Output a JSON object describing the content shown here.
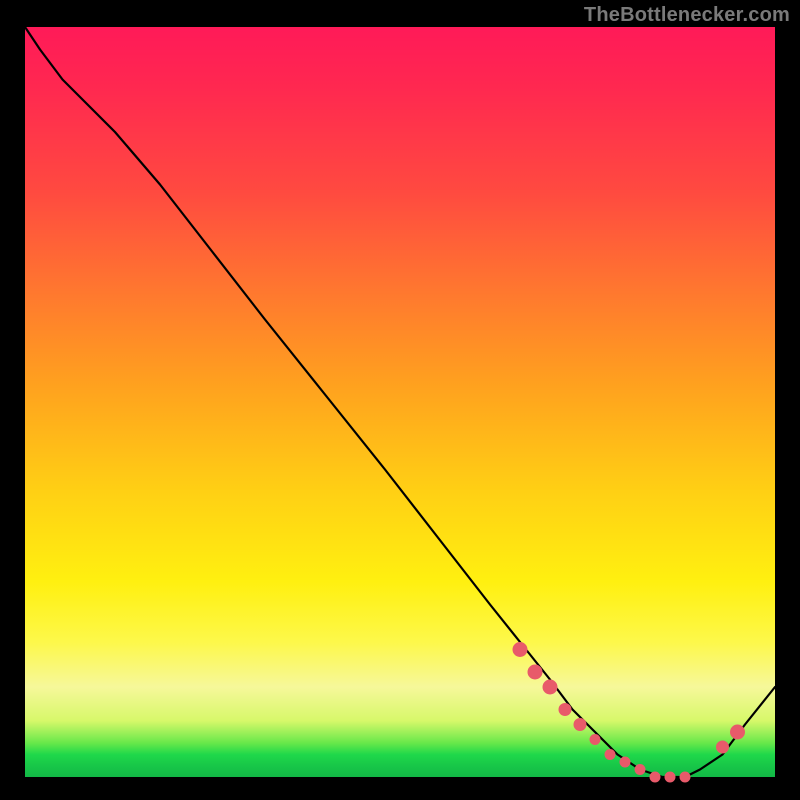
{
  "watermark": "TheBottlenecker.com",
  "chart_data": {
    "type": "line",
    "title": "",
    "xlabel": "",
    "ylabel": "",
    "xlim": [
      0,
      100
    ],
    "ylim": [
      0,
      100
    ],
    "series": [
      {
        "name": "bottleneck-curve",
        "x": [
          0,
          2,
          5,
          8,
          12,
          18,
          25,
          32,
          40,
          48,
          55,
          62,
          66,
          70,
          73,
          76,
          79,
          82,
          85,
          88,
          90,
          93,
          96,
          100
        ],
        "y": [
          100,
          97,
          93,
          90,
          86,
          79,
          70,
          61,
          51,
          41,
          32,
          23,
          18,
          13,
          9,
          6,
          3,
          1,
          0,
          0,
          1,
          3,
          7,
          12
        ]
      }
    ],
    "markers": {
      "name": "highlight-dots",
      "x": [
        66,
        68,
        70,
        72,
        74,
        76,
        78,
        80,
        82,
        84,
        86,
        88,
        93,
        95
      ],
      "y": [
        17,
        14,
        12,
        9,
        7,
        5,
        3,
        2,
        1,
        0,
        0,
        0,
        4,
        6
      ],
      "r": [
        7,
        7,
        7,
        6,
        6,
        5,
        5,
        5,
        5,
        5,
        5,
        5,
        6,
        7
      ]
    },
    "gradient_stops": [
      {
        "pos": 0.0,
        "color": "#ff1a58"
      },
      {
        "pos": 0.5,
        "color": "#ffb018"
      },
      {
        "pos": 0.8,
        "color": "#fff010"
      },
      {
        "pos": 0.96,
        "color": "#40d848"
      },
      {
        "pos": 1.0,
        "color": "#12b846"
      }
    ]
  }
}
